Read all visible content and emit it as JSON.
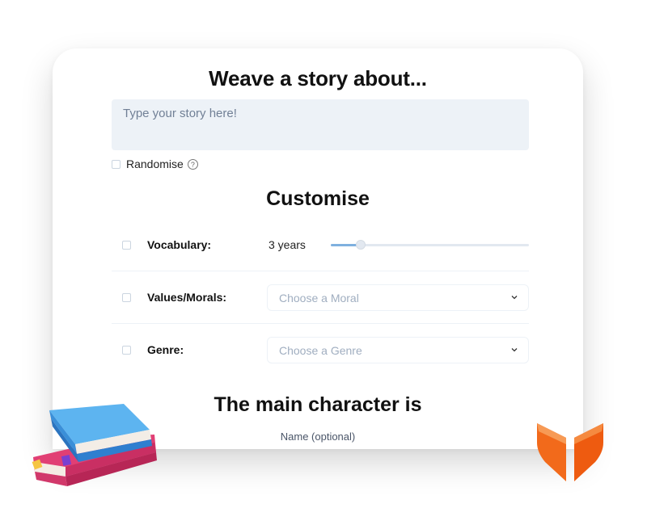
{
  "header": {
    "title": "Weave a story about..."
  },
  "story": {
    "placeholder": "Type your story here!",
    "value": ""
  },
  "randomise": {
    "label": "Randomise",
    "help_icon": "question-circle-icon",
    "checked": false
  },
  "customise": {
    "title": "Customise",
    "vocabulary": {
      "label": "Vocabulary:",
      "value": "3 years",
      "slider_fraction": 0.15
    },
    "morals": {
      "label": "Values/Morals:",
      "placeholder": "Choose a Moral"
    },
    "genre": {
      "label": "Genre:",
      "placeholder": "Choose a Genre"
    }
  },
  "character": {
    "title": "The main character is",
    "name_label": "Name (optional)"
  },
  "colors": {
    "accent": "#7fb0df",
    "input_bg": "#edf2f7",
    "logo": "#f26a1b"
  }
}
